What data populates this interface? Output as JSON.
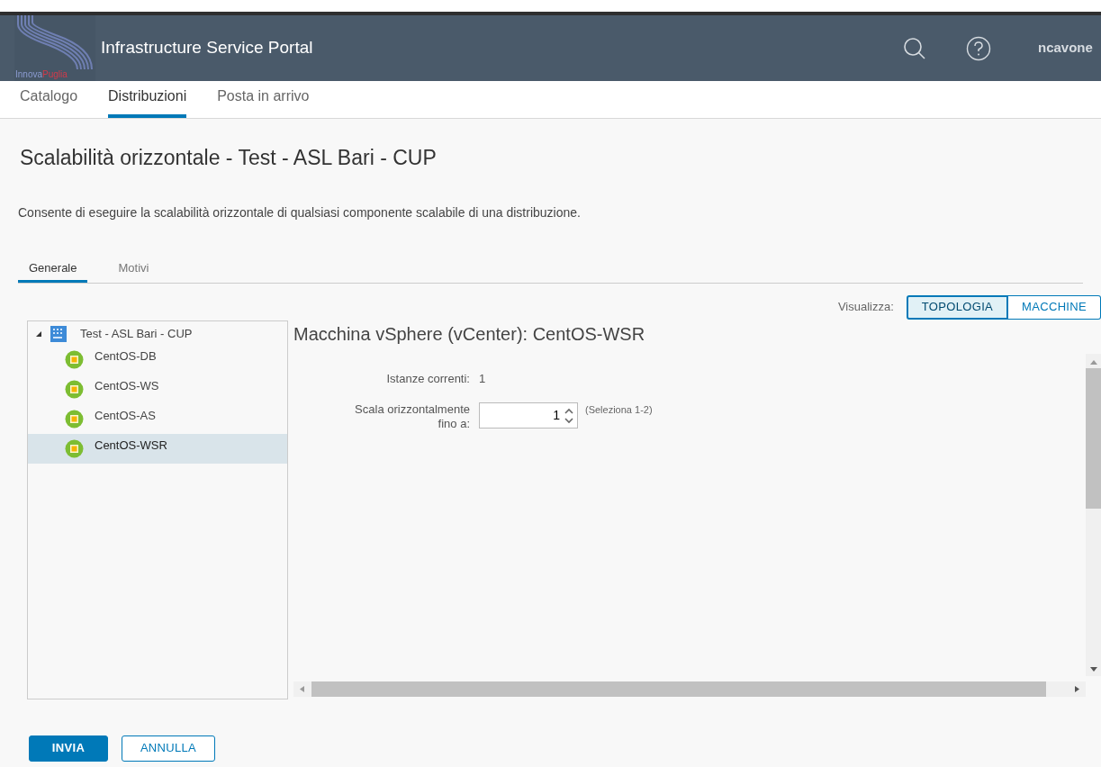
{
  "header": {
    "logo": {
      "part_1": "Innova",
      "part_2": "Puglia"
    },
    "title": "Infrastructure Service Portal",
    "user": "ncavone"
  },
  "nav_tabs": [
    {
      "label": "Catalogo",
      "selected": false
    },
    {
      "label": "Distribuzioni",
      "selected": true
    },
    {
      "label": "Posta in arrivo",
      "selected": false
    }
  ],
  "page_title": "Scalabilità orizzontale - Test - ASL Bari - CUP",
  "description": "Consente di eseguire la scalabilità orizzontale di qualsiasi componente scalabile di una distribuzione.",
  "form_tabs": [
    {
      "label": "Generale",
      "selected": true
    },
    {
      "label": "Motivi",
      "selected": false
    }
  ],
  "view_toggle": {
    "label": "Visualizza:",
    "options": [
      {
        "label": "TOPOLOGIA",
        "selected": true
      },
      {
        "label": "MACCHINE",
        "selected": false
      }
    ]
  },
  "tree": {
    "label": "Test - ASL Bari - CUP",
    "expanded": true,
    "children": [
      {
        "label": "CentOS-DB",
        "selected": false
      },
      {
        "label": "CentOS-WS",
        "selected": false
      },
      {
        "label": "CentOS-AS",
        "selected": false
      },
      {
        "label": "CentOS-WSR",
        "selected": true
      }
    ]
  },
  "detail": {
    "title": "Macchina vSphere (vCenter): CentOS-WSR",
    "current_label": "Istanze correnti:",
    "current_value": "1",
    "scale_label": "Scala orizzontalmente fino a:",
    "scale_value": "1",
    "scale_hint": "(Seleziona 1-2)"
  },
  "buttons": [
    {
      "label": "INVIA",
      "kind": "primary"
    },
    {
      "label": "ANNULLA",
      "kind": "secondary"
    }
  ]
}
